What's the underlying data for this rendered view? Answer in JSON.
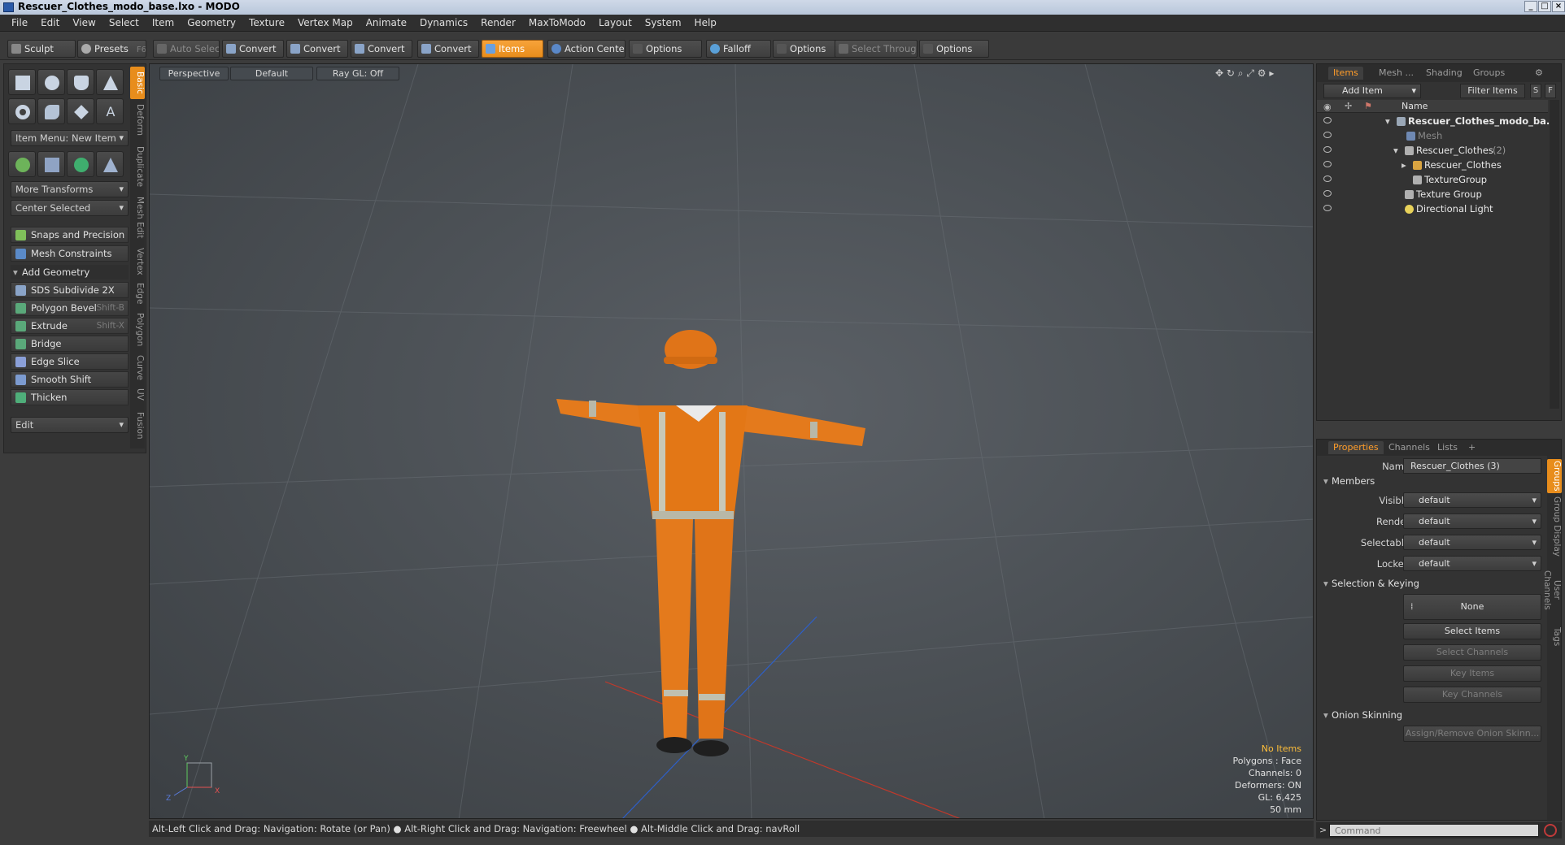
{
  "window": {
    "title": "Rescuer_Clothes_modo_base.lxo - MODO"
  },
  "menu": [
    "File",
    "Edit",
    "View",
    "Select",
    "Item",
    "Geometry",
    "Texture",
    "Vertex Map",
    "Animate",
    "Dynamics",
    "Render",
    "MaxToModo",
    "Layout",
    "System",
    "Help"
  ],
  "toolbar": {
    "sculpt": "Sculpt",
    "presets": "Presets",
    "presets_key": "F6",
    "auto_select": "Auto Select",
    "convert1": "Convert",
    "convert2": "Convert",
    "convert3": "Convert",
    "convert4": "Convert",
    "items": "Items",
    "action_center": "Action Center",
    "options1": "Options",
    "falloff": "Falloff",
    "options2": "Options",
    "select_through": "Select Through",
    "options3": "Options"
  },
  "left": {
    "item_menu": "Item Menu: New Item",
    "more_transforms": "More Transforms",
    "center_selected": "Center Selected",
    "snaps": "Snaps and Precision",
    "mesh_constraints": "Mesh Constraints",
    "add_geometry": "Add Geometry",
    "tools": [
      {
        "label": "SDS Subdivide 2X",
        "shortcut": ""
      },
      {
        "label": "Polygon Bevel",
        "shortcut": "Shift-B"
      },
      {
        "label": "Extrude",
        "shortcut": "Shift-X"
      },
      {
        "label": "Bridge",
        "shortcut": ""
      },
      {
        "label": "Edge Slice",
        "shortcut": ""
      },
      {
        "label": "Smooth Shift",
        "shortcut": ""
      },
      {
        "label": "Thicken",
        "shortcut": ""
      }
    ],
    "edit": "Edit",
    "vtabs": [
      "Basic",
      "Deform",
      "Duplicate",
      "Mesh Edit",
      "Vertex",
      "Edge",
      "Polygon",
      "Curve",
      "UV",
      "Fusion"
    ]
  },
  "viewport": {
    "view": "Perspective",
    "shading": "Default",
    "raygl": "Ray GL: Off",
    "info": {
      "no_items": "No Items",
      "polygons": "Polygons : Face",
      "channels": "Channels: 0",
      "deformers": "Deformers: ON",
      "gl": "GL: 6,425",
      "lens": "50 mm"
    },
    "axis": {
      "x": "X",
      "y": "Y",
      "z": "Z"
    }
  },
  "status": {
    "hint1": "Alt-Left Click and Drag: Navigation: Rotate (or Pan)",
    "hint2": "Alt-Right Click and Drag: Navigation: Freewheel",
    "hint3": "Alt-Middle Click and Drag: navRoll"
  },
  "items_panel": {
    "tabs": [
      "Items",
      "Mesh ...",
      "Shading",
      "Groups"
    ],
    "add_item": "Add Item",
    "filter_items": "Filter Items",
    "btn_s": "S",
    "btn_f": "F",
    "col_name": "Name",
    "tree": [
      {
        "label": "Rescuer_Clothes_modo_ba...",
        "count": ""
      },
      {
        "label": "Mesh",
        "count": ""
      },
      {
        "label": "Rescuer_Clothes",
        "count": "(2)"
      },
      {
        "label": "Rescuer_Clothes",
        "count": ""
      },
      {
        "label": "TextureGroup",
        "count": ""
      },
      {
        "label": "Texture Group",
        "count": ""
      },
      {
        "label": "Directional Light",
        "count": ""
      }
    ]
  },
  "properties": {
    "tabs": [
      "Properties",
      "Channels",
      "Lists",
      "+"
    ],
    "name_label": "Name",
    "name_value": "Rescuer_Clothes (3)",
    "members": "Members",
    "rows": [
      {
        "label": "Visible",
        "value": "default"
      },
      {
        "label": "Render",
        "value": "default"
      },
      {
        "label": "Selectable",
        "value": "default"
      },
      {
        "label": "Locked",
        "value": "default"
      }
    ],
    "selection_keying": "Selection & Keying",
    "none": "None",
    "select_items": "Select Items",
    "select_channels": "Select Channels",
    "key_items": "Key Items",
    "key_channels": "Key Channels",
    "onion": "Onion Skinning",
    "assign_onion": "Assign/Remove Onion Skinn...",
    "side_tabs": [
      "Groups",
      "Group Display",
      "User Channels",
      "Tags"
    ]
  },
  "command": {
    "prompt": ">",
    "placeholder": "Command"
  }
}
